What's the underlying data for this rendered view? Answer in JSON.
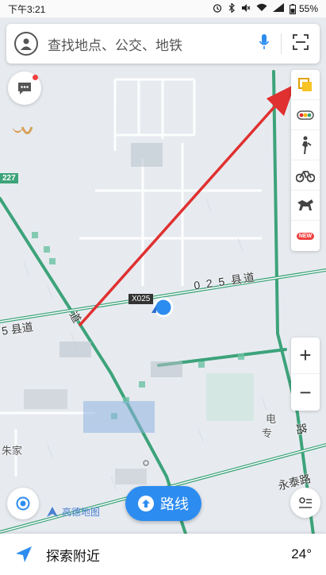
{
  "status_bar": {
    "time": "下午3:21",
    "battery": "55%"
  },
  "search": {
    "placeholder": "查找地点、公交、地铁"
  },
  "map": {
    "road_labels": {
      "county_road_right": "0 2 5 县道",
      "county_road_left": "5 县道",
      "route_code": "X025",
      "road_shield": "227",
      "yongtai_road": "永泰路",
      "vertical_road_right": "路",
      "vertical_road_left": "道",
      "place_left": "朱家",
      "place_right_1": "电",
      "place_right_2": "专"
    }
  },
  "right_tools": [
    {
      "name": "layers",
      "icon": "layers-icon"
    },
    {
      "name": "traffic",
      "icon": "traffic-light-icon"
    },
    {
      "name": "walk",
      "icon": "walker-icon"
    },
    {
      "name": "bike",
      "icon": "bicycle-icon"
    },
    {
      "name": "horse",
      "icon": "horse-icon"
    },
    {
      "name": "new",
      "icon": "new-badge-icon",
      "badge": "NEW"
    }
  ],
  "zoom": {
    "in": "+",
    "out": "−"
  },
  "brand": {
    "text": "高德地图"
  },
  "route_button": {
    "label": "路线"
  },
  "bottom_bar": {
    "explore_label": "探索附近",
    "temperature": "24°"
  },
  "colors": {
    "accent_blue": "#2d8cf0",
    "road_green": "#3da37a",
    "arrow_red": "#e03030",
    "map_bg": "#e7ebf0"
  }
}
